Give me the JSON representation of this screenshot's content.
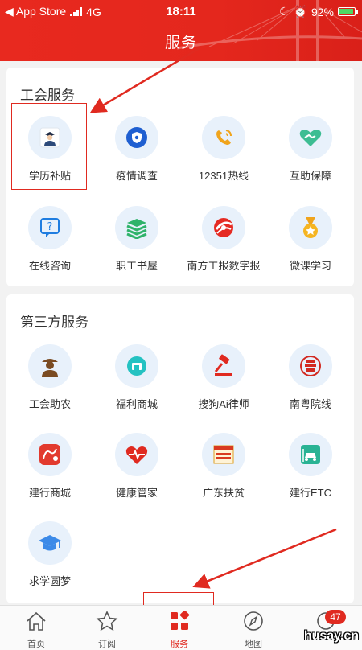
{
  "status_bar": {
    "carrier": "◀ App Store",
    "network": "4G",
    "time": "18:11",
    "battery_percent": "92%",
    "battery_level": 0.92
  },
  "header": {
    "title": "服务"
  },
  "union_services": {
    "title": "工会服务",
    "items": [
      {
        "label": "学历补贴",
        "icon": "graduate-person-icon"
      },
      {
        "label": "疫情调查",
        "icon": "shield-icon"
      },
      {
        "label": "12351热线",
        "icon": "phone-icon"
      },
      {
        "label": "互助保障",
        "icon": "heart-handshake-icon"
      },
      {
        "label": "在线咨询",
        "icon": "question-chat-icon"
      },
      {
        "label": "职工书屋",
        "icon": "books-icon"
      },
      {
        "label": "南方工报数字报",
        "icon": "newspaper-logo-icon"
      },
      {
        "label": "微课学习",
        "icon": "medal-icon"
      }
    ]
  },
  "third_party_services": {
    "title": "第三方服务",
    "items": [
      {
        "label": "工会助农",
        "icon": "farmer-icon"
      },
      {
        "label": "福利商城",
        "icon": "shop-icon"
      },
      {
        "label": "搜狗Ai律师",
        "icon": "gavel-icon"
      },
      {
        "label": "南粤院线",
        "icon": "cinema-seal-icon"
      },
      {
        "label": "建行商城",
        "icon": "ccb-mall-icon"
      },
      {
        "label": "健康管家",
        "icon": "heart-pulse-icon"
      },
      {
        "label": "广东扶贫",
        "icon": "poverty-relief-icon"
      },
      {
        "label": "建行ETC",
        "icon": "etc-car-icon"
      },
      {
        "label": "求学圆梦",
        "icon": "grad-cap-icon"
      }
    ]
  },
  "bottom_nav": {
    "items": [
      {
        "label": "首页",
        "icon": "home-icon"
      },
      {
        "label": "订阅",
        "icon": "star-icon"
      },
      {
        "label": "服务",
        "icon": "services-grid-icon",
        "active": true
      },
      {
        "label": "地图",
        "icon": "compass-icon"
      },
      {
        "label": "",
        "icon": "message-icon"
      }
    ],
    "badge": "47"
  },
  "watermark": "husay.cn",
  "colors": {
    "brand_red": "#e4271d",
    "icon_bg": "#e8f1fb",
    "active": "#e02a20"
  }
}
